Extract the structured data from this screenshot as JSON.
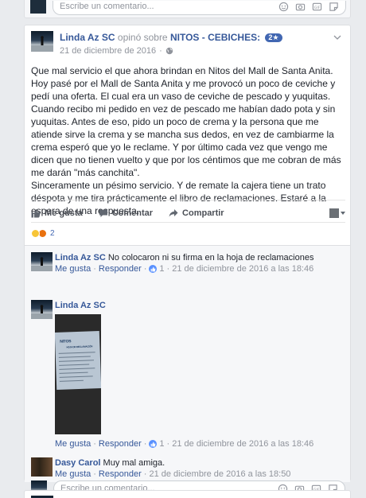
{
  "top_stub": {
    "placeholder": "Escribe un comentario..."
  },
  "post": {
    "author": "Linda Az SC",
    "verb": " opinó sobre ",
    "page": "NITOS - CEBICHES:",
    "badge": "2★",
    "date": "21 de diciembre de 2016",
    "privacy_icon": "globe-icon",
    "body_lines": [
      "Que mal servicio el que ahora brindan en Nitos del Mall de Santa Anita. Hoy pasé por el Mall de Santa Anita y me provocó un poco de ceviche y pedí una oferta. El cual era un vaso de ceviche de pescado y yuquitas. Cuando recibo mi pedido en vez de pescado me habían dado pota y sin yuquitas. Antes de eso, pido un poco de crema y la persona que me atiende sirve la crema y se mancha sus dedos, en vez de cambiarme la crema esperó que yo le reclame. Y por último cada vez que vengo me dicen que no tienen vuelto y que por los céntimos que me cobran de más me darán \"más canchita\".",
      "Sinceramente un pésimo servicio. Y de remate la cajera tiene un trato déspota y me tira prácticamente el libro de reclamaciones. Estaré a la espera de una respuesta."
    ],
    "actions": {
      "like": "Me gusta",
      "comment": "Comentar",
      "share": "Compartir"
    },
    "reaction_count": "2"
  },
  "comments": [
    {
      "name": "Linda Az SC",
      "text": " No colocaron ni su firma en la hoja de reclamaciones",
      "like": "Me gusta",
      "sep1": " · ",
      "reply": "Responder",
      "sep2": " · ",
      "likes": "1",
      "time": " · 21 de diciembre de 2016 a las 18:46"
    },
    {
      "name": "Linda Az SC",
      "photo_text": "NITOS",
      "photo_subtext": "HOJA DE RECLAMACIÓN",
      "like": "Me gusta",
      "sep1": " · ",
      "reply": "Responder",
      "sep2": " · ",
      "likes": "1",
      "time": " · 21 de diciembre de 2016 a las 18:46"
    },
    {
      "name": "Dasy Carol",
      "text": " Muy mal amiga.",
      "like": "Me gusta",
      "sep1": " · ",
      "reply": "Responder",
      "time": " · 21 de diciembre de 2016 a las 18:50"
    }
  ],
  "composer": {
    "placeholder": "Escribe un comentario..."
  },
  "colors": {
    "link": "#365899",
    "accent": "#4267b2",
    "muted": "#90949c",
    "background": "#e9ebee"
  }
}
